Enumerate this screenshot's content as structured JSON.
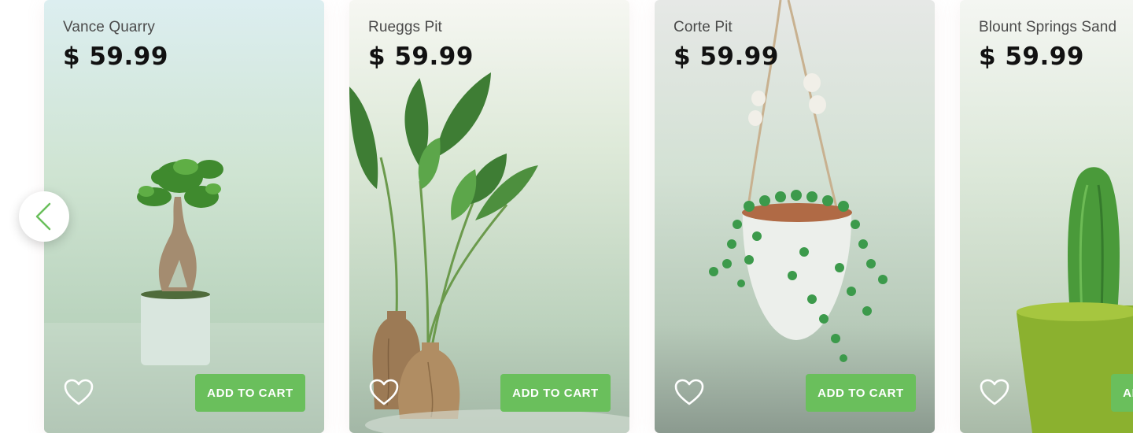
{
  "products": [
    {
      "name": "Vance Quarry",
      "price": "$ 59.99",
      "add_label": "ADD TO CART",
      "image": "bonsai-tree-icon"
    },
    {
      "name": "Rueggs Pit",
      "price": "$ 59.99",
      "add_label": "ADD TO CART",
      "image": "strelitzia-plant-icon"
    },
    {
      "name": "Corte Pit",
      "price": "$ 59.99",
      "add_label": "ADD TO CART",
      "image": "hanging-string-of-pearls-icon"
    },
    {
      "name": "Blount Springs Sand",
      "price": "$ 59.99",
      "add_label": "ADD TO CART",
      "image": "cactus-icon"
    }
  ],
  "navigation": {
    "prev_icon": "chevron-left-icon"
  },
  "colors": {
    "accent": "#6abf5c",
    "card_tint": "#cfe3d1",
    "heart": "#ffffff"
  }
}
